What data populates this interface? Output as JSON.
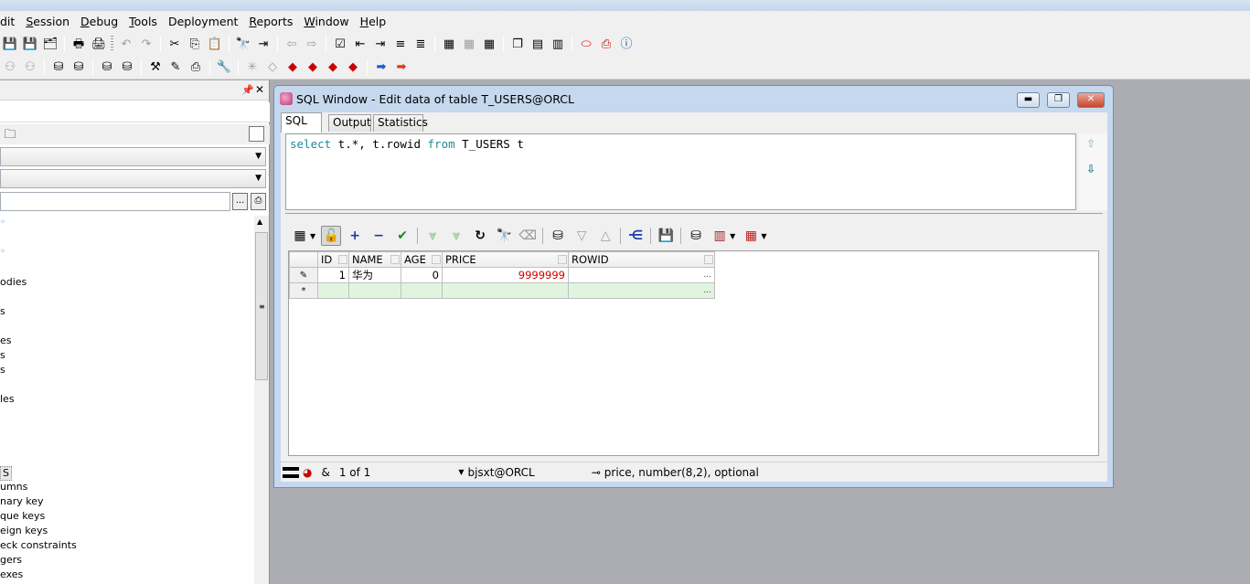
{
  "menu": {
    "items": [
      {
        "label": "dit",
        "acc": "",
        "rest": "dit"
      },
      {
        "label": "Session",
        "acc": "S",
        "rest": "ession"
      },
      {
        "label": "Debug",
        "acc": "D",
        "rest": "ebug"
      },
      {
        "label": "Tools",
        "acc": "T",
        "rest": "ools"
      },
      {
        "label": "Deployment",
        "acc": "",
        "rest": "Deployment"
      },
      {
        "label": "Reports",
        "acc": "R",
        "rest": "eports"
      },
      {
        "label": "Window",
        "acc": "W",
        "rest": "indow"
      },
      {
        "label": "Help",
        "acc": "H",
        "rest": "elp"
      }
    ]
  },
  "left_panel": {
    "tree_items": [
      "odies",
      "s",
      "es",
      "s",
      "s",
      "les",
      "S",
      "umns",
      "nary key",
      "que keys",
      "eign keys",
      "eck constraints",
      "gers",
      "exes"
    ],
    "browse_button": "..."
  },
  "sql_window": {
    "title": "SQL Window - Edit data of table T_USERS@ORCL",
    "tabs": [
      "SQL",
      "Output",
      "Statistics"
    ],
    "active_tab": "SQL",
    "query": {
      "kw1": "select",
      "t1": " t.*, t.rowid ",
      "kw2": "from",
      "t2": " T_USERS t"
    },
    "grid": {
      "columns": [
        "ID",
        "NAME",
        "AGE",
        "PRICE",
        "ROWID"
      ],
      "rows": [
        {
          "indicator": "✎",
          "ID": "1",
          "NAME": "华为",
          "AGE": "0",
          "PRICE": "9999999",
          "ROWID": ""
        }
      ],
      "new_row_indicator": "*",
      "ellipsis": "..."
    },
    "status": {
      "ampersand": "&",
      "record": "1 of 1",
      "connection": "bjsxt@ORCL",
      "column_info": "price, number(8,2), optional"
    }
  },
  "colors": {
    "keyword": "#1e8a9a",
    "modified_value": "#d10000",
    "new_row": "#e0f5df",
    "window_frame": "#c5d8ee"
  }
}
